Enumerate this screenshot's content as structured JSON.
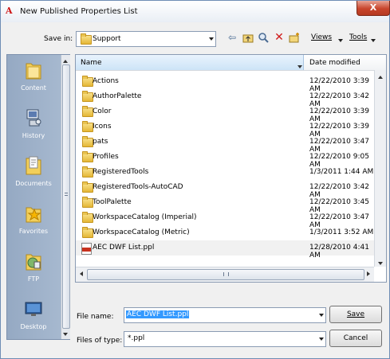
{
  "window": {
    "title": "New Published Properties List",
    "close_glyph": "X"
  },
  "save_in": {
    "label": "Save in:",
    "value": "Support"
  },
  "toolbar": {
    "views_label": "Views",
    "tools_label": "Tools"
  },
  "places": [
    {
      "label": "Content",
      "icon": "content-folder-icon"
    },
    {
      "label": "History",
      "icon": "history-computer-icon"
    },
    {
      "label": "Documents",
      "icon": "documents-folder-icon"
    },
    {
      "label": "Favorites",
      "icon": "favorites-star-folder-icon"
    },
    {
      "label": "FTP",
      "icon": "ftp-globe-folder-icon"
    },
    {
      "label": "Desktop",
      "icon": "desktop-monitor-icon"
    }
  ],
  "columns": {
    "name": "Name",
    "date": "Date modified"
  },
  "files": [
    {
      "name": "Actions",
      "date": "12/22/2010 3:39 AM",
      "type": "folder"
    },
    {
      "name": "AuthorPalette",
      "date": "12/22/2010 3:42 AM",
      "type": "folder"
    },
    {
      "name": "Color",
      "date": "12/22/2010 3:39 AM",
      "type": "folder"
    },
    {
      "name": "Icons",
      "date": "12/22/2010 3:39 AM",
      "type": "folder"
    },
    {
      "name": "pats",
      "date": "12/22/2010 3:47 AM",
      "type": "folder"
    },
    {
      "name": "Profiles",
      "date": "12/22/2010 9:05 AM",
      "type": "folder"
    },
    {
      "name": "RegisteredTools",
      "date": "1/3/2011 1:44 AM",
      "type": "folder"
    },
    {
      "name": "RegisteredTools-AutoCAD",
      "date": "12/22/2010 3:42 AM",
      "type": "folder"
    },
    {
      "name": "ToolPalette",
      "date": "12/22/2010 3:45 AM",
      "type": "folder"
    },
    {
      "name": "WorkspaceCatalog (Imperial)",
      "date": "12/22/2010 3:47 AM",
      "type": "folder"
    },
    {
      "name": "WorkspaceCatalog (Metric)",
      "date": "1/3/2011 3:52 AM",
      "type": "folder"
    },
    {
      "name": "AEC DWF List.ppl",
      "date": "12/28/2010 4:41 AM",
      "type": "ppl-file"
    }
  ],
  "file_name": {
    "label": "File name:",
    "value": "AEC DWF List.ppl"
  },
  "file_type": {
    "label": "Files of type:",
    "value": "*.ppl"
  },
  "buttons": {
    "save": "Save",
    "cancel": "Cancel"
  }
}
